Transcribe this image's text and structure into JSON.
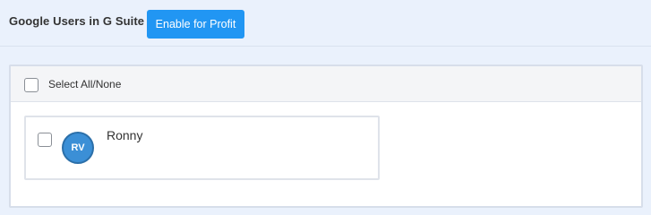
{
  "header": {
    "title": "Google Users in G Suite",
    "enable_button": "Enable for Profit"
  },
  "panel": {
    "select_all_label": "Select All/None",
    "users": [
      {
        "initials": "RV",
        "name": "Ronny",
        "checked": false
      }
    ]
  },
  "colors": {
    "page_background": "#eaf1fc",
    "accent_button": "#2196f3",
    "avatar": "#3b8fd6"
  }
}
